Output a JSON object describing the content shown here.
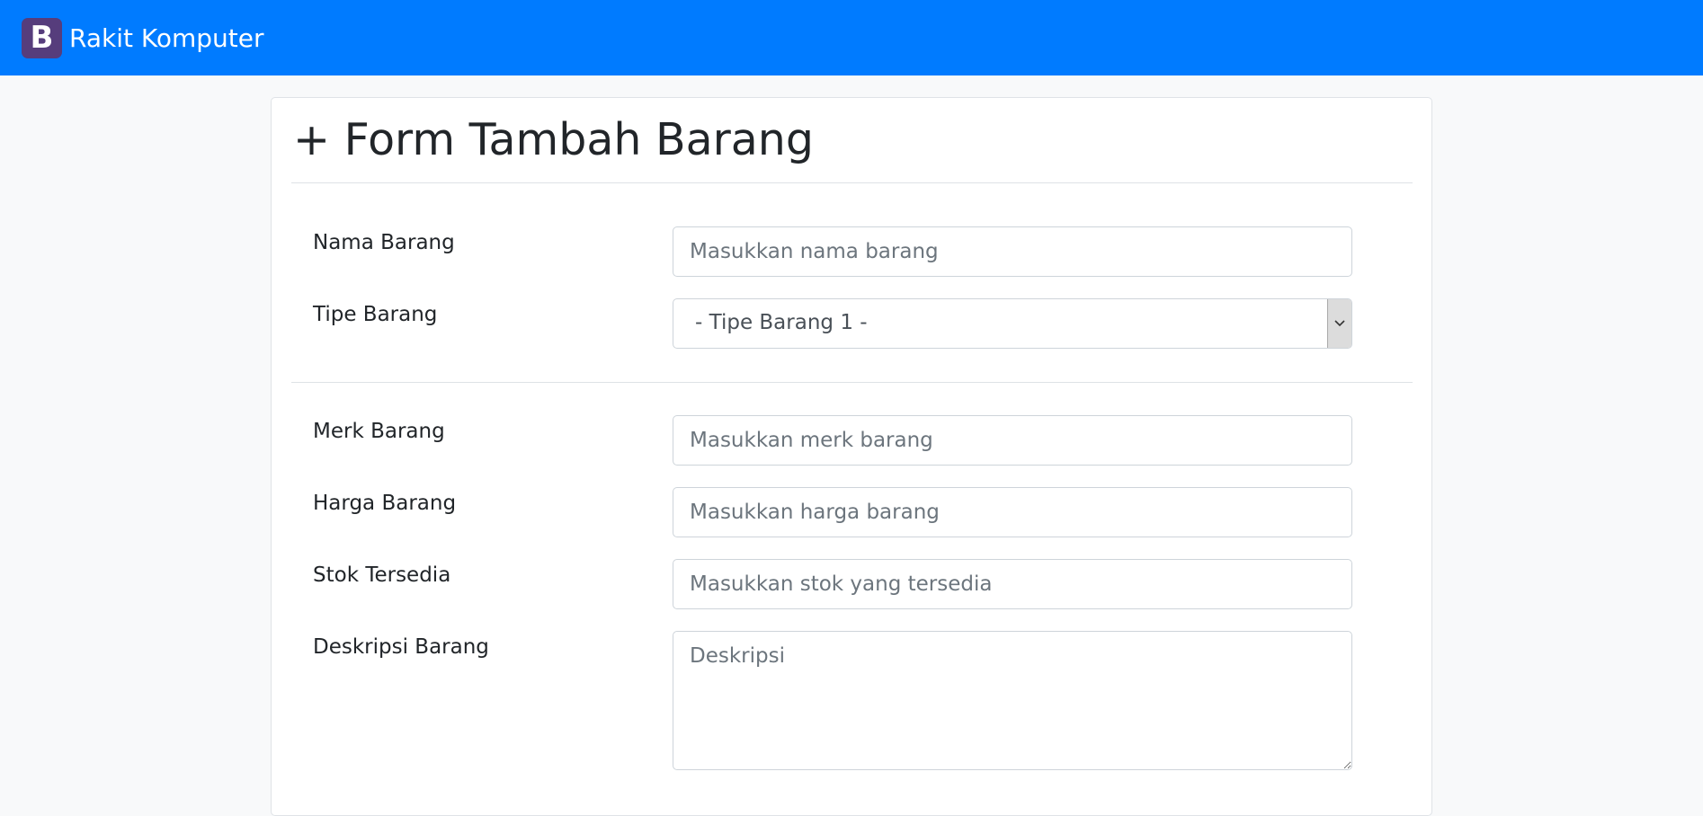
{
  "navbar": {
    "logo_letter": "B",
    "brand": "Rakit Komputer"
  },
  "form": {
    "title": "+ Form Tambah Barang",
    "fields": {
      "nama": {
        "label": "Nama Barang",
        "placeholder": "Masukkan nama barang"
      },
      "tipe": {
        "label": "Tipe Barang",
        "selected": "- Tipe Barang 1 -"
      },
      "merk": {
        "label": "Merk Barang",
        "placeholder": "Masukkan merk barang"
      },
      "harga": {
        "label": "Harga Barang",
        "placeholder": "Masukkan harga barang"
      },
      "stok": {
        "label": "Stok Tersedia",
        "placeholder": "Masukkan stok yang tersedia"
      },
      "deskripsi": {
        "label": "Deskripsi Barang",
        "placeholder": "Deskripsi"
      }
    }
  },
  "colors": {
    "navbar": "#007bff",
    "logo": "#563d7c",
    "page_bg": "#f8f9fa"
  }
}
